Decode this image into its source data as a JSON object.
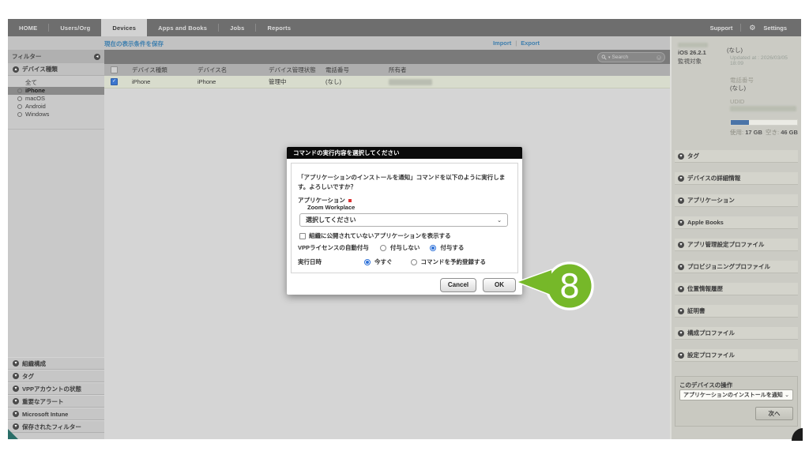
{
  "nav": {
    "tabs": [
      "HOME",
      "Users/Org",
      "Devices",
      "Apps and Books",
      "Jobs",
      "Reports"
    ],
    "support": "Support",
    "settings": "Settings"
  },
  "subbar": {
    "save_view": "現在の表示条件を保存",
    "import": "Import",
    "export": "Export"
  },
  "sidebar": {
    "title": "フィルター",
    "device_type_section": "デバイス種類",
    "options": [
      "全て",
      "iPhone",
      "macOS",
      "Android",
      "Windows"
    ],
    "selected": "iPhone",
    "collapsed_sections": [
      "組織構成",
      "タグ",
      "VPPアカウントの状態",
      "重要なアラート",
      "Microsoft Intune",
      "保存されたフィルター"
    ]
  },
  "table": {
    "search_placeholder": "Search",
    "headers": [
      "デバイス種類",
      "デバイス名",
      "デバイス管理状態",
      "電話番号",
      "所有者"
    ],
    "row": {
      "type": "iPhone",
      "name": "iPhone",
      "status": "管理中",
      "phone": "(なし)"
    }
  },
  "panel": {
    "os": "iOS 26.2.1",
    "supervision": "監視対象",
    "top_value": "(なし)",
    "updated": "Updated at : 2026/03/05 18:09",
    "phone_label": "電話番号",
    "phone_value": "(なし)",
    "udid_label": "UDID",
    "used_label": "使用:",
    "used_value": "17 GB",
    "free_label": "空き:",
    "free_value": "46 GB",
    "storage_fill_style": "width:27%",
    "sections": [
      "タグ",
      "デバイスの詳細情報",
      "アプリケーション",
      "Apple Books",
      "アプリ管理設定プロファイル",
      "プロビジョニングプロファイル",
      "位置情報履歴",
      "証明書",
      "構成プロファイル",
      "設定プロファイル"
    ],
    "action_title": "このデバイスの操作",
    "action_dropdown": "アプリケーションのインストールを通知",
    "next_button": "次へ"
  },
  "modal": {
    "title": "コマンドの実行内容を選択してください",
    "message": "「アプリケーションのインストールを通知」コマンドを以下のように実行します。よろしいですか？",
    "app_label": "アプリケーション",
    "app_name": "Zoom Workplace",
    "select_placeholder": "選択してください",
    "checkbox_label": "組織に公開されていないアプリケーションを表示する",
    "vpp_label": "VPPライセンスの自動付与",
    "vpp_no": "付与しない",
    "vpp_yes": "付与する",
    "exec_label": "実行日時",
    "exec_now": "今すぐ",
    "exec_schedule": "コマンドを予約登録する",
    "cancel": "Cancel",
    "ok": "OK"
  },
  "annotation": {
    "number": "8"
  },
  "colors": {
    "accent_green": "#76b829",
    "link_blue": "#3f7fae",
    "check_blue": "#3c77cf"
  }
}
